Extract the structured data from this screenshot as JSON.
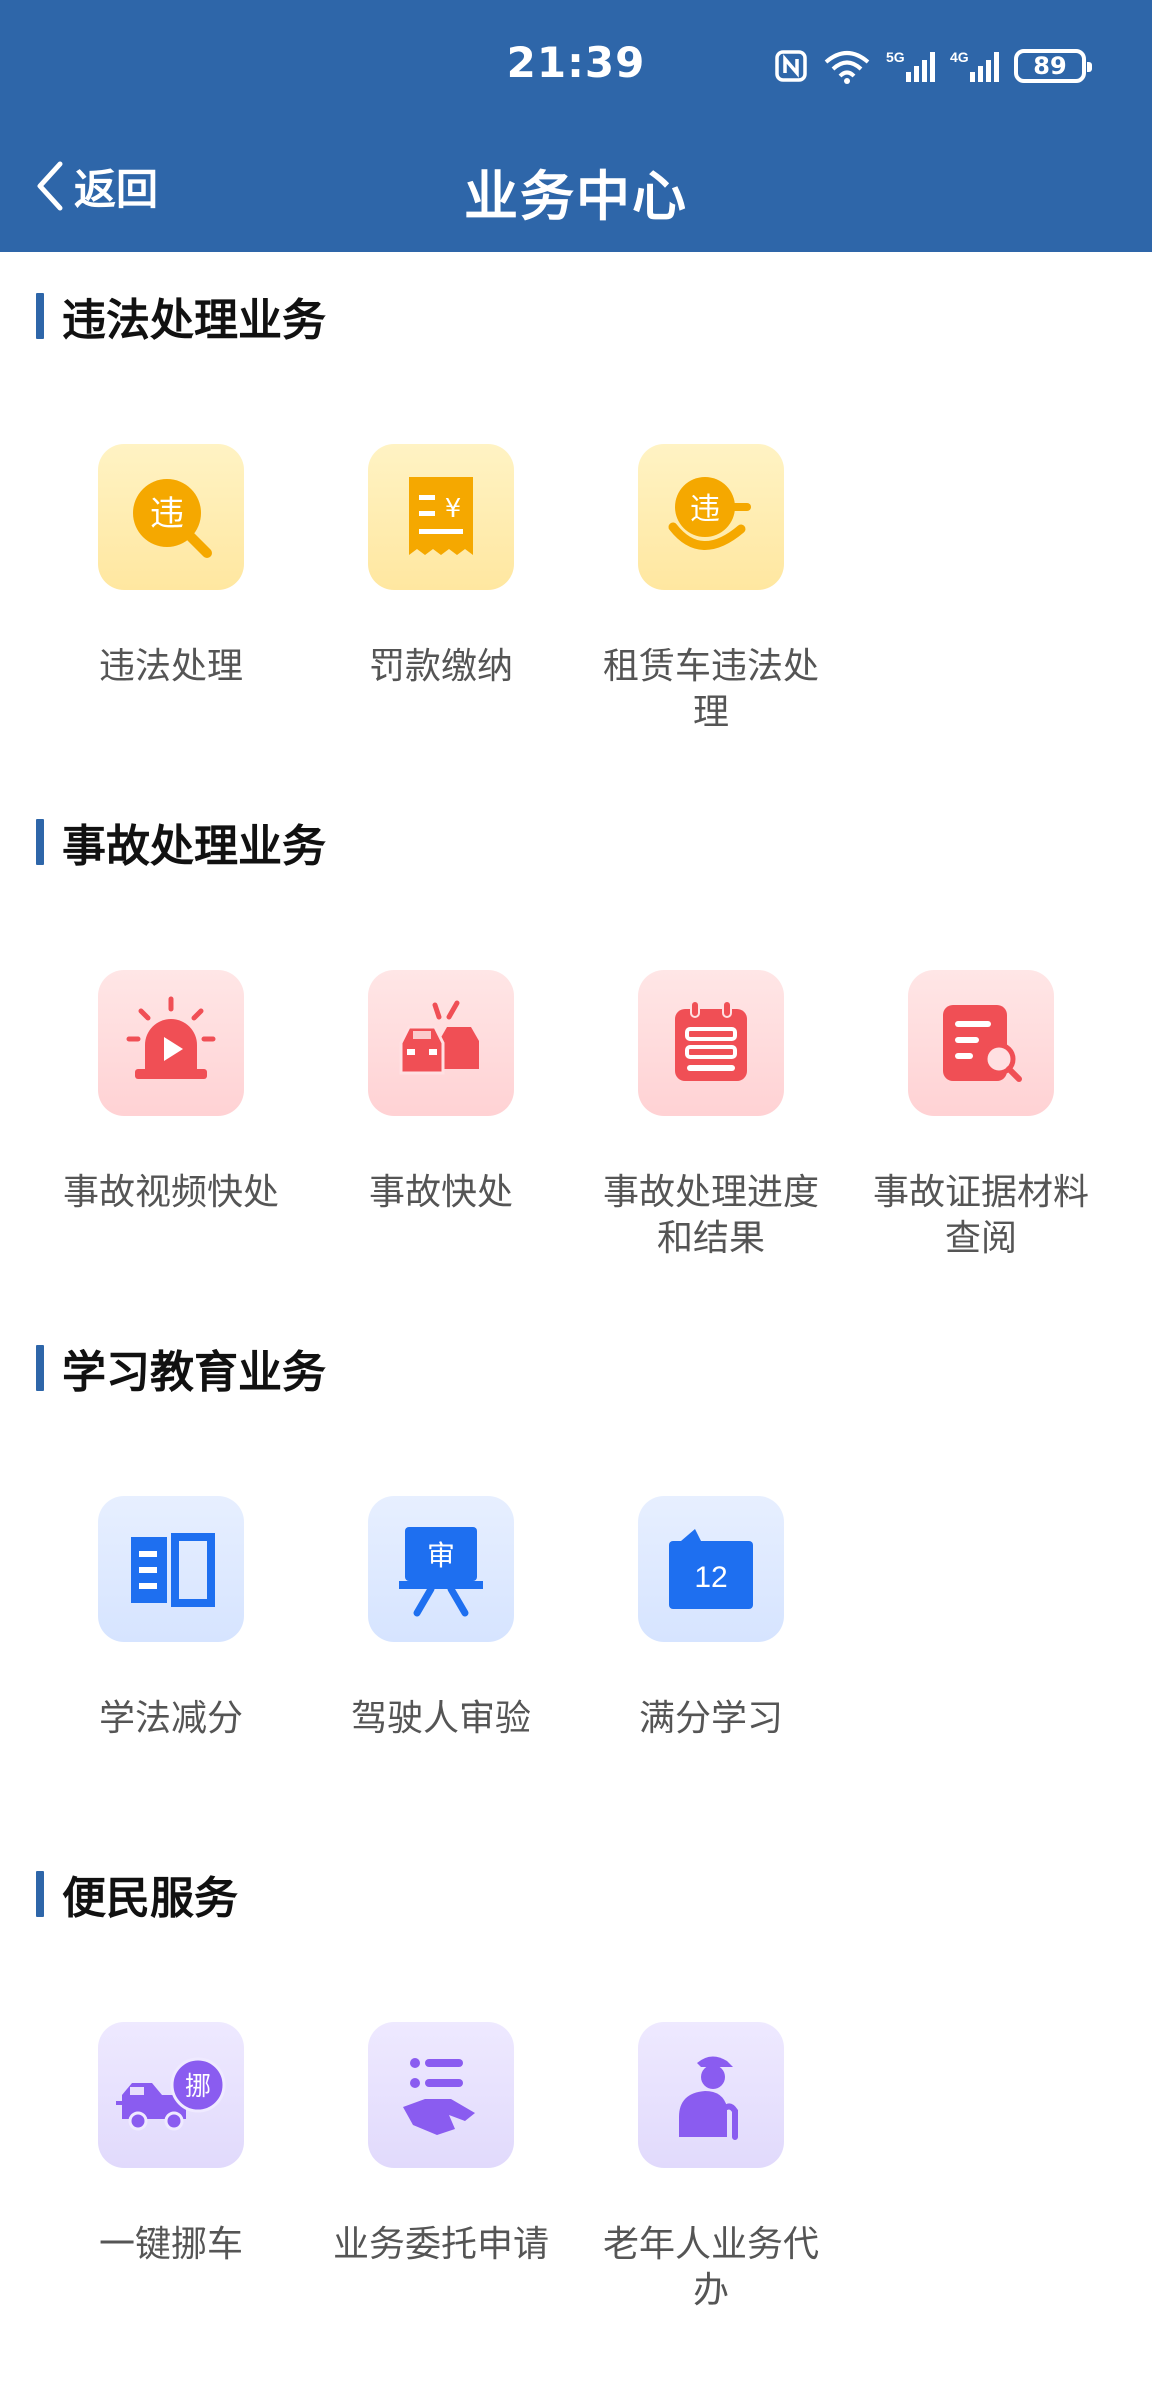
{
  "status_bar": {
    "time": "21:39",
    "battery": "89"
  },
  "nav": {
    "back_label": "返回",
    "title": "业务中心"
  },
  "sections": [
    {
      "title": "违法处理业务",
      "items": [
        {
          "label": "违法处理",
          "icon": "violation-search-icon",
          "color": "#f5a800"
        },
        {
          "label": "罚款缴纳",
          "icon": "fine-receipt-icon",
          "color": "#f5a800"
        },
        {
          "label": "租赁车违法处理",
          "icon": "rental-violation-icon",
          "color": "#f5a800"
        }
      ]
    },
    {
      "title": "事故处理业务",
      "items": [
        {
          "label": "事故视频快处",
          "icon": "alarm-video-icon",
          "color": "#f04f55"
        },
        {
          "label": "事故快处",
          "icon": "car-crash-icon",
          "color": "#f04f55"
        },
        {
          "label": "事故处理进度和结果",
          "icon": "calendar-list-icon",
          "color": "#f04f55"
        },
        {
          "label": "事故证据材料查阅",
          "icon": "document-search-icon",
          "color": "#f04f55"
        }
      ]
    },
    {
      "title": "学习教育业务",
      "items": [
        {
          "label": "学法减分",
          "icon": "open-book-icon",
          "color": "#1e6ff0"
        },
        {
          "label": "驾驶人审验",
          "icon": "review-board-icon",
          "color": "#1e6ff0"
        },
        {
          "label": "满分学习",
          "icon": "calendar-12-icon",
          "color": "#1e6ff0"
        }
      ]
    },
    {
      "title": "便民服务",
      "items": [
        {
          "label": "一键挪车",
          "icon": "move-car-icon",
          "color": "#8a5cf0"
        },
        {
          "label": "业务委托申请",
          "icon": "hand-list-icon",
          "color": "#8a5cf0"
        },
        {
          "label": "老年人业务代办",
          "icon": "elderly-icon",
          "color": "#8a5cf0"
        }
      ]
    }
  ],
  "icon_text": {
    "wei": "违",
    "yen": "¥",
    "shen": "审",
    "num12": "12",
    "nuo": "挪"
  },
  "colors": {
    "header": "#2e66a9",
    "accent_bar": "#2e66a9"
  }
}
